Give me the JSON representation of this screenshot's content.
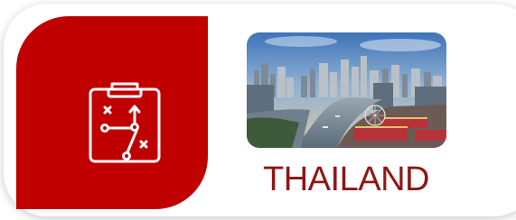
{
  "destination": {
    "country_name": "THAILAND",
    "icon": "strategy-clipboard-icon",
    "photo": "bangkok-skyline-river-photo"
  },
  "colors": {
    "accent_red": "#c00000",
    "title_red": "#8f1616",
    "background": "#ffffff"
  }
}
